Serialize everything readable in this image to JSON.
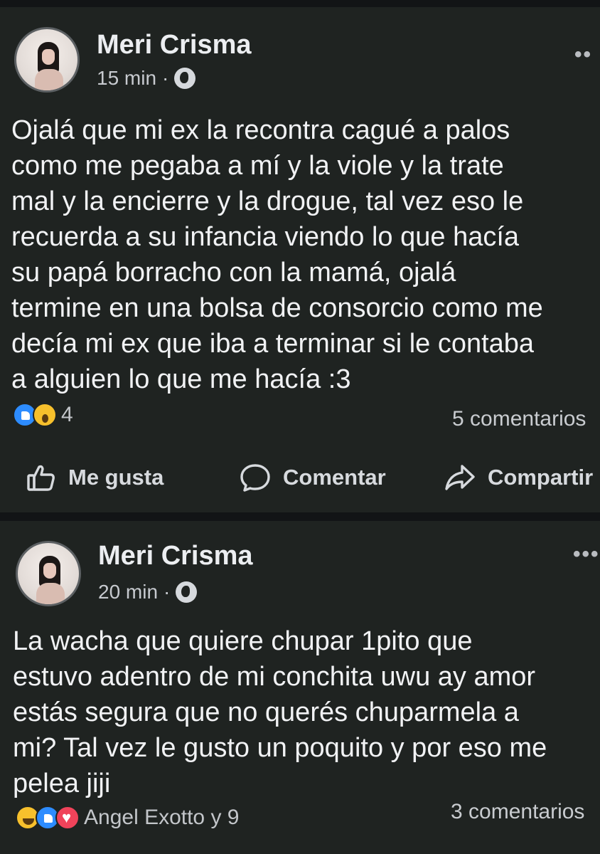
{
  "posts": [
    {
      "author": "Meri Crisma",
      "time": "15 min",
      "separator": "·",
      "privacy_icon": "globe-icon",
      "more_icon": "more-dots-icon",
      "text": "Ojalá que mi ex la recontra cagué a palos\ncomo me pegaba a mí y la viole y la trate\nmal y la encierre y la drogue, tal vez eso le\nrecuerda a su infancia viendo lo que hacía\nsu papá borracho con la mamá, ojalá\ntermine en una bolsa de consorcio como me\ndecía mi ex que iba a terminar si le contaba\na alguien lo que me hacía  :3",
      "reaction_icons": [
        "like-icon",
        "wow-icon"
      ],
      "reaction_count": "4",
      "comments": "5 comentarios"
    },
    {
      "author": "Meri Crisma",
      "time": "20 min",
      "separator": "·",
      "privacy_icon": "globe-icon",
      "more_icon": "more-dots-icon",
      "text": "La wacha que quiere chupar 1pito que\nestuvo adentro de mi conchita uwu ay amor\nestás segura que no querés chuparmela a\nmi? Tal vez le gusto un poquito y por eso me\npelea jiji",
      "reaction_icons": [
        "haha-icon",
        "like-icon",
        "love-icon"
      ],
      "reaction_count": "Angel Exotto y 9",
      "comments": "3 comentarios"
    }
  ],
  "actions": {
    "like": "Me gusta",
    "comment": "Comentar",
    "share": "Compartir"
  },
  "colors": {
    "background": "#121416",
    "card": "#1f2321",
    "text": "#f1f2f4",
    "secondary_text": "#c7cacf",
    "like_blue": "#2d8cff",
    "wow_yellow": "#f7c02c",
    "love_red": "#f0435a"
  }
}
